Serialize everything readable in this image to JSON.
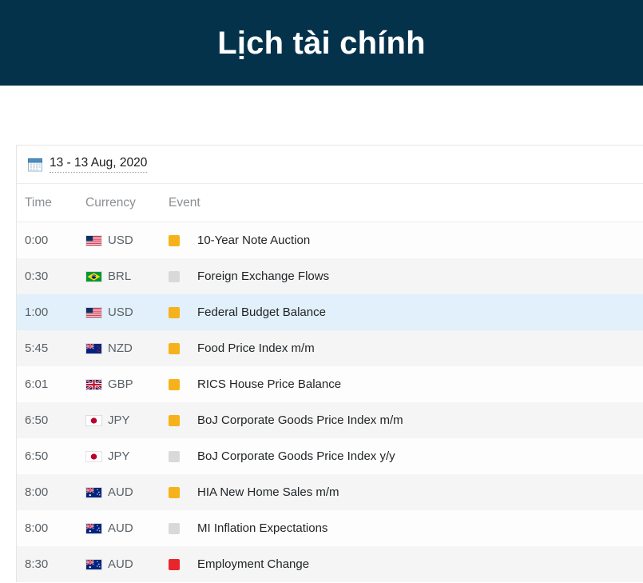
{
  "header": {
    "title": "Lịch tài chính",
    "background_color": "#05324b",
    "text_color": "#ffffff"
  },
  "calendar": {
    "date_picker": {
      "icon": "calendar-icon",
      "value": "13 - 13 Aug, 2020"
    },
    "columns": {
      "time": "Time",
      "currency": "Currency",
      "event": "Event"
    },
    "impact_colors": {
      "low": "#d9d9d9",
      "medium": "#f6b21b",
      "high": "#e8252a"
    },
    "row_colors": {
      "default": "#fdfdfd",
      "alternate": "#f5f5f5",
      "highlight": "#e1f0fa"
    },
    "rows": [
      {
        "time": "0:00",
        "currency": "USD",
        "flag": "flag-us-icon",
        "impact": "medium",
        "event": "10-Year Note Auction",
        "style": "default"
      },
      {
        "time": "0:30",
        "currency": "BRL",
        "flag": "flag-br-icon",
        "impact": "low",
        "event": "Foreign Exchange Flows",
        "style": "alternate"
      },
      {
        "time": "1:00",
        "currency": "USD",
        "flag": "flag-us-icon",
        "impact": "medium",
        "event": "Federal Budget Balance",
        "style": "highlight"
      },
      {
        "time": "5:45",
        "currency": "NZD",
        "flag": "flag-nz-icon",
        "impact": "medium",
        "event": "Food Price Index m/m",
        "style": "alternate"
      },
      {
        "time": "6:01",
        "currency": "GBP",
        "flag": "flag-gb-icon",
        "impact": "medium",
        "event": "RICS House Price Balance",
        "style": "default"
      },
      {
        "time": "6:50",
        "currency": "JPY",
        "flag": "flag-jp-icon",
        "impact": "medium",
        "event": "BoJ Corporate Goods Price Index m/m",
        "style": "alternate"
      },
      {
        "time": "6:50",
        "currency": "JPY",
        "flag": "flag-jp-icon",
        "impact": "low",
        "event": "BoJ Corporate Goods Price Index y/y",
        "style": "default"
      },
      {
        "time": "8:00",
        "currency": "AUD",
        "flag": "flag-au-icon",
        "impact": "medium",
        "event": "HIA New Home Sales m/m",
        "style": "alternate"
      },
      {
        "time": "8:00",
        "currency": "AUD",
        "flag": "flag-au-icon",
        "impact": "low",
        "event": "MI Inflation Expectations",
        "style": "default"
      },
      {
        "time": "8:30",
        "currency": "AUD",
        "flag": "flag-au-icon",
        "impact": "high",
        "event": "Employment Change",
        "style": "alternate"
      }
    ]
  }
}
